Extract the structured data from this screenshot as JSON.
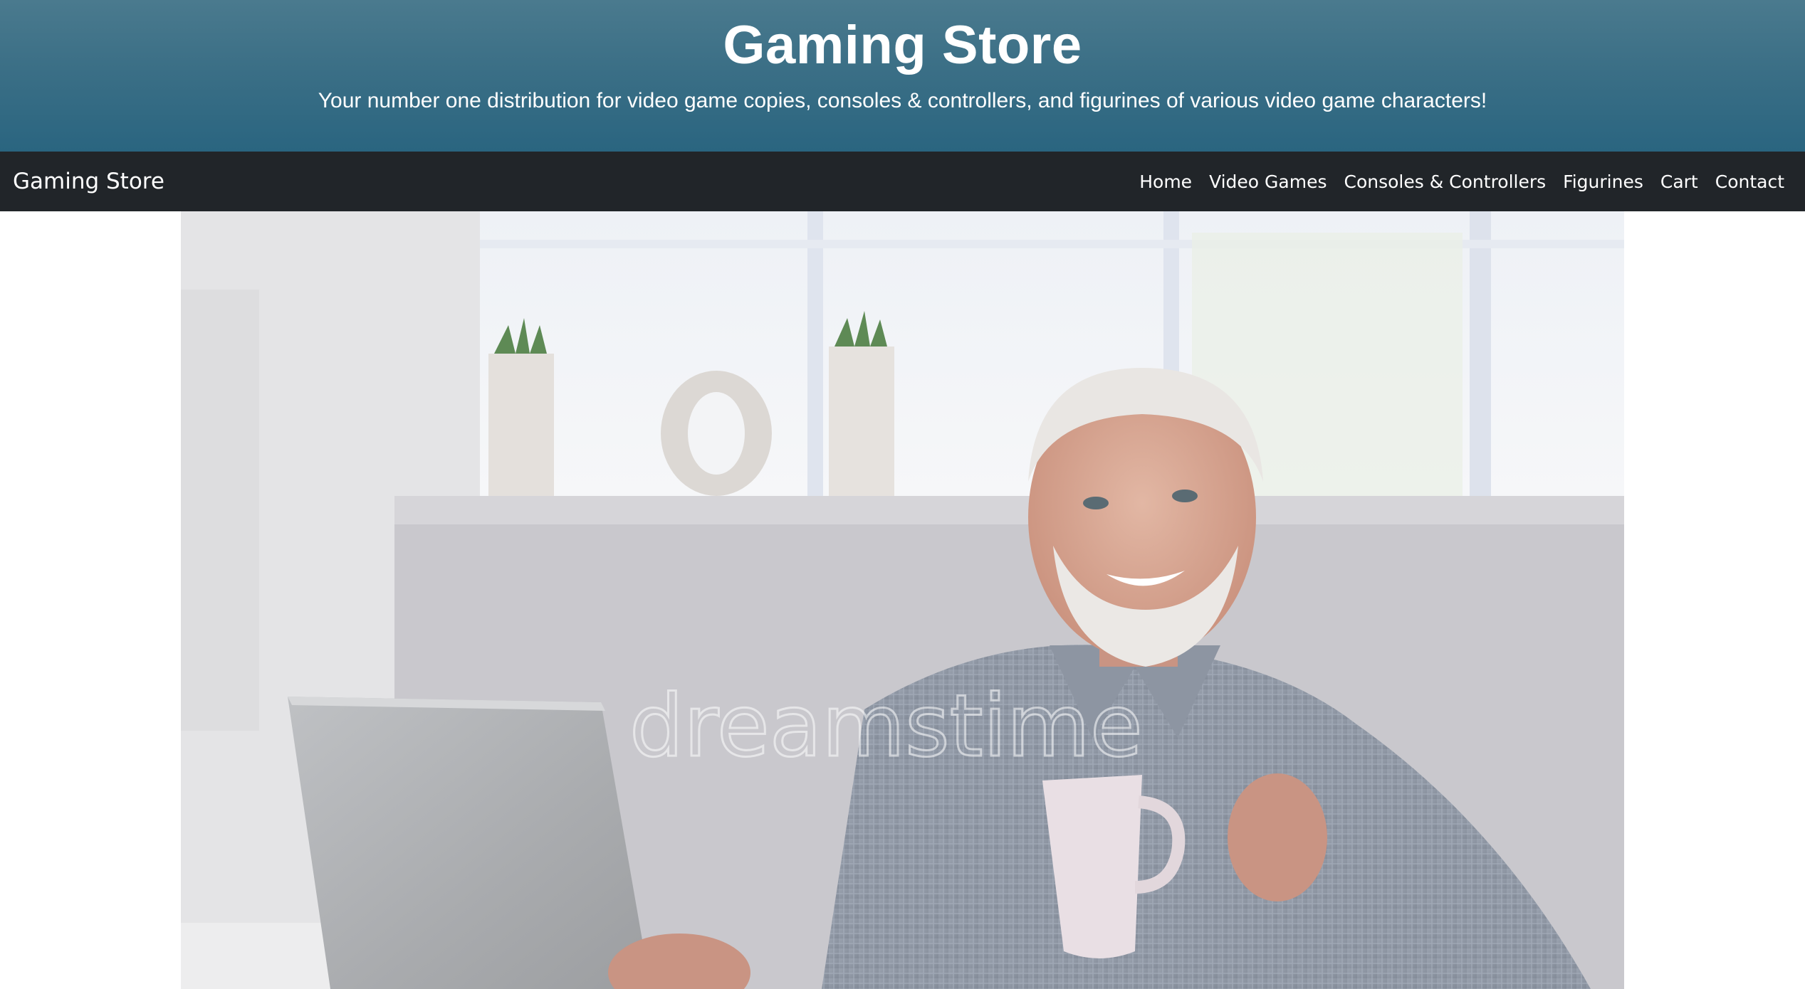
{
  "header": {
    "title": "Gaming Store",
    "subtitle": "Your number one distribution for video game copies, consoles & controllers, and figurines of various video game characters!"
  },
  "navbar": {
    "brand": "Gaming Store",
    "links": [
      {
        "label": "Home"
      },
      {
        "label": "Video Games"
      },
      {
        "label": "Consoles & Controllers"
      },
      {
        "label": "Figurines"
      },
      {
        "label": "Cart"
      },
      {
        "label": "Contact"
      }
    ]
  },
  "hero": {
    "watermark": "dreamstime"
  },
  "colors": {
    "header_top": "#4a7a8e",
    "header_bottom": "#2a6580",
    "navbar_bg": "#212529",
    "text": "#ffffff"
  }
}
